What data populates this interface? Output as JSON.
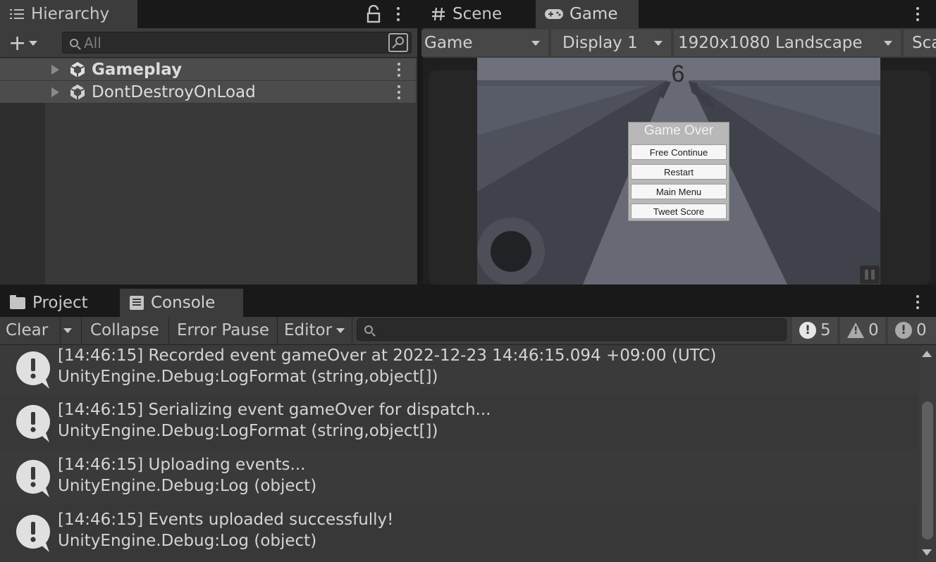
{
  "hierarchy": {
    "tab_label": "Hierarchy",
    "search_placeholder": "All",
    "add_label": "+",
    "items": [
      {
        "name": "Gameplay"
      },
      {
        "name": "DontDestroyOnLoad"
      }
    ]
  },
  "game_panel": {
    "tabs": [
      {
        "label": "Scene",
        "icon": "hash-icon"
      },
      {
        "label": "Game",
        "icon": "gamepad-icon"
      }
    ],
    "toolbar": {
      "view_mode": "Game",
      "display": "Display 1",
      "resolution": "1920x1080 Landscape",
      "scale_label": "Sca"
    },
    "scene": {
      "score": "6",
      "menu_title": "Game Over",
      "buttons": [
        "Free Continue",
        "Restart",
        "Main Menu",
        "Tweet Score"
      ]
    }
  },
  "bottom_panel": {
    "tabs": [
      {
        "label": "Project",
        "icon": "folder-icon"
      },
      {
        "label": "Console",
        "icon": "console-icon"
      }
    ]
  },
  "console": {
    "toolbar": {
      "clear": "Clear",
      "collapse": "Collapse",
      "error_pause": "Error Pause",
      "editor": "Editor"
    },
    "counts": {
      "log": "5",
      "warning": "0",
      "error": "0"
    },
    "entries": [
      {
        "line1": "[14:46:15] Recorded event gameOver at 2022-12-23 14:46:15.094 +09:00 (UTC)",
        "line2": "UnityEngine.Debug:LogFormat (string,object[])"
      },
      {
        "line1": "[14:46:15] Serializing event gameOver for dispatch...",
        "line2": "UnityEngine.Debug:LogFormat (string,object[])"
      },
      {
        "line1": "[14:46:15] Uploading events...",
        "line2": "UnityEngine.Debug:Log (object)"
      },
      {
        "line1": "[14:46:15] Events uploaded successfully!",
        "line2": "UnityEngine.Debug:Log (object)"
      }
    ]
  },
  "colors": {
    "panel_bg": "#383838",
    "toolbar_bg": "#3c3c3c",
    "tabbar_bg": "#191919",
    "row_highlight": "#4c4c4c",
    "text": "#d2d2d2"
  }
}
